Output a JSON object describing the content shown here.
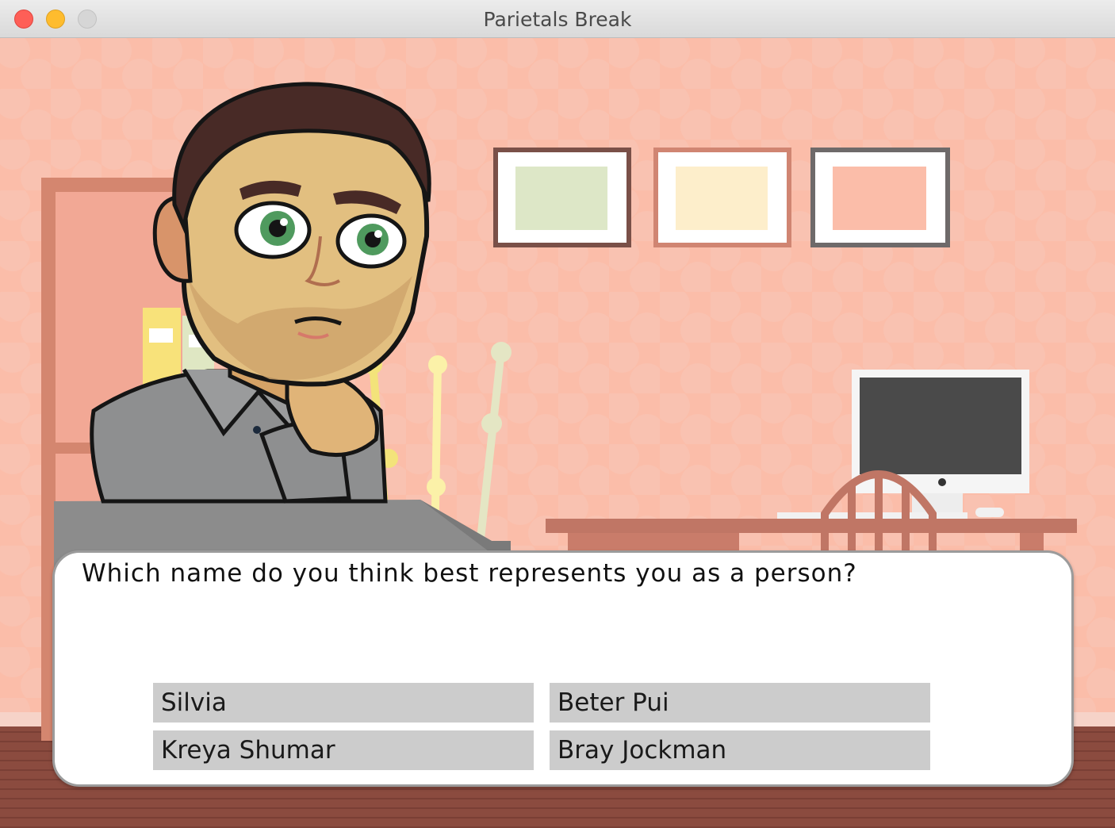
{
  "window": {
    "title": "Parietals Break"
  },
  "dialog": {
    "question": "Which name do you think best represents you as a person?",
    "choices": [
      {
        "label": "Silvia"
      },
      {
        "label": "Beter Pui"
      },
      {
        "label": "Kreya Shumar"
      },
      {
        "label": "Bray Jockman"
      }
    ]
  },
  "colors": {
    "wall": "#fbbda9",
    "wall_dots": "#f7c6b6",
    "floor": "#8a4a3e",
    "trim": "#c97a66",
    "choice_bg": "#cccccc",
    "dialog_bg": "#ffffff"
  },
  "scene": {
    "background": "office-wall-scene",
    "character": "bearded-man-thinking-avatar",
    "icons": [
      "close-icon",
      "minimize-icon",
      "zoom-icon"
    ]
  }
}
